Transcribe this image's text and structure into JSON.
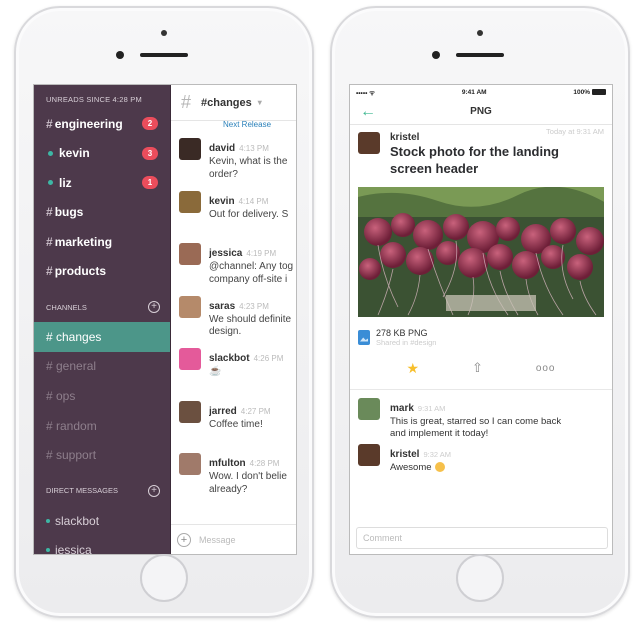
{
  "left_phone": {
    "sidebar": {
      "unreads_header": "UNREADS SINCE 4:28 PM",
      "unreads": [
        {
          "prefix": "#",
          "label": "engineering",
          "badge": "2",
          "presence": false
        },
        {
          "prefix": "",
          "label": "kevin",
          "badge": "3",
          "presence": true
        },
        {
          "prefix": "",
          "label": "liz",
          "badge": "1",
          "presence": true
        },
        {
          "prefix": "#",
          "label": "bugs",
          "badge": "",
          "presence": false
        },
        {
          "prefix": "#",
          "label": "marketing",
          "badge": "",
          "presence": false
        },
        {
          "prefix": "#",
          "label": "products",
          "badge": "",
          "presence": false
        }
      ],
      "channels_header": "CHANNELS",
      "channels": [
        {
          "label": "# changes",
          "active": true
        },
        {
          "label": "# general",
          "active": false
        },
        {
          "label": "# ops",
          "active": false
        },
        {
          "label": "# random",
          "active": false
        },
        {
          "label": "# support",
          "active": false
        }
      ],
      "dm_header": "DIRECT MESSAGES",
      "direct_messages": [
        "slackbot",
        "jessica"
      ]
    },
    "chat": {
      "channel_title": "#changes",
      "next_release": "Next Release",
      "messages": [
        {
          "name": "david",
          "time": "4:13 PM",
          "lines": [
            "Kevin, what is the",
            "order?"
          ],
          "avatar_color": "#3a2a25"
        },
        {
          "name": "kevin",
          "time": "4:14 PM",
          "lines": [
            "Out for delivery. S"
          ],
          "avatar_color": "#8a6a3a"
        },
        {
          "name": "jessica",
          "time": "4:19 PM",
          "lines": [
            "@channel: Any tog",
            "company off-site i"
          ],
          "avatar_color": "#9a6a55"
        },
        {
          "name": "saras",
          "time": "4:23 PM",
          "lines": [
            "We should definite",
            "design."
          ],
          "avatar_color": "#b58a6a"
        },
        {
          "name": "slackbot",
          "time": "4:26 PM",
          "lines": [
            "☕"
          ],
          "avatar_color": "#e45a9a"
        },
        {
          "name": "jarred",
          "time": "4:27 PM",
          "lines": [
            "Coffee time!"
          ],
          "avatar_color": "#6b5040"
        },
        {
          "name": "mfulton",
          "time": "4:28 PM",
          "lines": [
            "Wow. I don't belie",
            "already?"
          ],
          "avatar_color": "#a07a6a"
        }
      ],
      "input_placeholder": "Message"
    }
  },
  "right_phone": {
    "status_bar": {
      "carrier": "•••••  ᯤ",
      "time": "9:41 AM",
      "battery": "100%"
    },
    "nav_title": "PNG",
    "post": {
      "author": "kristel",
      "time": "Today at 9:31 AM",
      "title_lines": [
        "Stock photo for the landing",
        "screen header"
      ]
    },
    "file": {
      "size": "278 KB PNG",
      "shared": "Shared in #design"
    },
    "comments": [
      {
        "name": "mark",
        "time": "9:31 AM",
        "lines": [
          "This is great, starred so I can come back",
          "and implement it today!"
        ],
        "avatar_color": "#6a8a5a"
      },
      {
        "name": "kristel",
        "time": "9:32 AM",
        "lines": [
          "Awesome"
        ],
        "avatar_color": "#5a3a2a"
      }
    ],
    "comment_placeholder": "Comment"
  }
}
